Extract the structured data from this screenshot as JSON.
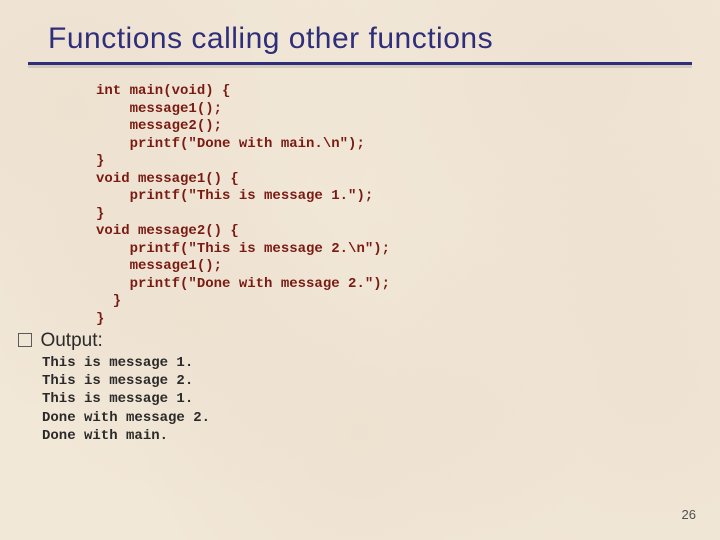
{
  "title": "Functions calling other functions",
  "code": "int main(void) {\n    message1();\n    message2();\n    printf(\"Done with main.\\n\");\n}\nvoid message1() {\n    printf(\"This is message 1.\");\n}\nvoid message2() {\n    printf(\"This is message 2.\\n\");\n    message1();\n    printf(\"Done with message 2.\");\n  }\n}",
  "output_label": "Output:",
  "output": "This is message 1.\nThis is message 2.\nThis is message 1.\nDone with message 2.\nDone with main.",
  "page_number": "26"
}
